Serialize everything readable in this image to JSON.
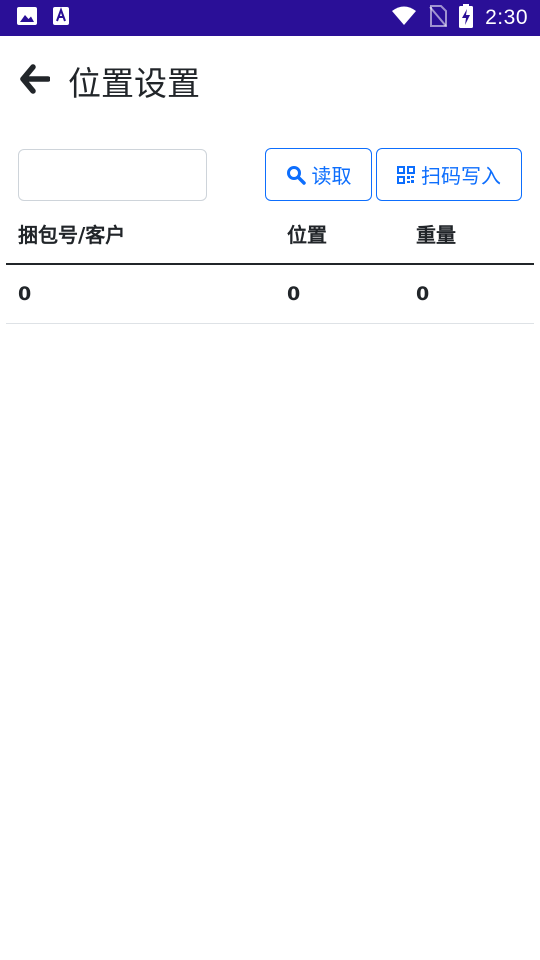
{
  "status_bar": {
    "time": "2:30",
    "icons": [
      "image-icon",
      "a-box-icon",
      "wifi-icon",
      "no-sim-icon",
      "battery-charging-icon"
    ],
    "background": "#2a0f97"
  },
  "header": {
    "back_icon": "arrow-left-icon",
    "title": "位置设置"
  },
  "toolbar": {
    "search_value": "",
    "search_placeholder": "",
    "read_label": "读取",
    "read_icon": "search-icon",
    "scan_label": "扫码写入",
    "scan_icon": "qrcode-icon",
    "accent": "#0d6efd"
  },
  "table": {
    "columns": [
      "捆包号/客户",
      "位置",
      "重量"
    ],
    "rows": [
      [
        "0",
        "0",
        "0"
      ]
    ]
  }
}
